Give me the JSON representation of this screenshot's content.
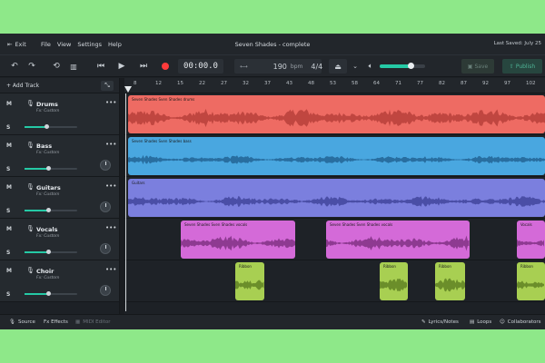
{
  "menubar": {
    "exit_label": "Exit",
    "menus": [
      "File",
      "View",
      "Settings",
      "Help"
    ],
    "project_title": "Seven Shades - complete",
    "last_saved": "Last Saved: July 25"
  },
  "toolbar": {
    "time": "00:00.0",
    "tempo": "190",
    "tempo_unit": "bpm",
    "time_signature": "4/4",
    "volume_fraction": 0.68,
    "save_label": "Save",
    "publish_label": "Publish"
  },
  "tracks_header": {
    "add_track_label": "+ Add Track",
    "mute_label": "M",
    "solo_label": "S"
  },
  "ruler": {
    "ticks": [
      "8",
      "12",
      "15",
      "22",
      "27",
      "32",
      "37",
      "43",
      "48",
      "53",
      "58",
      "64",
      "71",
      "77",
      "82",
      "87",
      "92",
      "97",
      "102",
      "106",
      "11"
    ]
  },
  "tracks": [
    {
      "name": "Drums",
      "fx": "Fx: Custom",
      "volume": 0.42,
      "color": "#ee6b63"
    },
    {
      "name": "Bass",
      "fx": "Fx: Custom",
      "volume": 0.45,
      "color": "#49a7e0"
    },
    {
      "name": "Guitars",
      "fx": "Fx: Custom",
      "volume": 0.45,
      "color": "#7b7fde"
    },
    {
      "name": "Vocals",
      "fx": "Fx: Custom",
      "volume": 0.45,
      "color": "#d46ad8"
    },
    {
      "name": "Choir",
      "fx": "Fx: Custom",
      "volume": 0.45,
      "color": "#a8cf52"
    }
  ],
  "clips": {
    "drums": "Seven Shades  Sven Shades  drums",
    "bass": "Seven Shades  Sven Shades  bass",
    "guitars": "Guitars",
    "vocals_1": "Seven Shades  Sven Shades  vocals",
    "vocals_2": "Seven Shades  Sven Shades  vocals",
    "vocals_3": "Vocals",
    "choir_1": "Ribbon",
    "choir_2": "Ribbon",
    "choir_3": "Ribbon",
    "choir_4": "Ribbon"
  },
  "footer": {
    "source_label": "Source",
    "fx_label": "Fx Effects",
    "midi_label": "MIDI Editor",
    "lyrics_label": "Lyrics/Notes",
    "loops_label": "Loops",
    "collab_label": "Collaborators"
  }
}
